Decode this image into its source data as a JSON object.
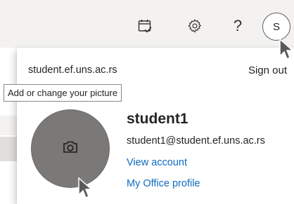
{
  "topbar": {
    "icons": [
      "calendar-check-icon",
      "gear-icon",
      "help-icon"
    ],
    "help_glyph": "?",
    "avatar_initial": "S"
  },
  "account_panel": {
    "organization": "student.ef.uns.ac.rs",
    "sign_out_label": "Sign out",
    "photo_tooltip": "Add or change your picture",
    "photo_icon": "camera-icon",
    "display_name": "student1",
    "email": "student1@student.ef.uns.ac.rs",
    "view_account_label": "View account",
    "office_profile_label": "My Office profile"
  },
  "colors": {
    "topbar_bg": "#f3f2f1",
    "link": "#0f6cbd",
    "photo_bg": "#7a7978"
  }
}
